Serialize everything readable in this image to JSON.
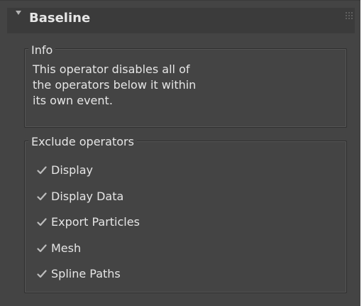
{
  "rollout": {
    "title": "Baseline",
    "expanded": true
  },
  "info": {
    "label": "Info",
    "lines": [
      "This operator disables all of",
      "the operators below it within",
      "its own event."
    ]
  },
  "exclude": {
    "label": "Exclude operators",
    "items": [
      {
        "label": "Display",
        "checked": true
      },
      {
        "label": "Display Data",
        "checked": true
      },
      {
        "label": "Export Particles",
        "checked": true
      },
      {
        "label": "Mesh",
        "checked": true
      },
      {
        "label": "Spline Paths",
        "checked": true
      }
    ]
  },
  "colors": {
    "panel_bg": "#444444",
    "header_bg": "#3b3b3b",
    "text": "#e6e6e6",
    "checkmark": "#bdbdbd"
  }
}
